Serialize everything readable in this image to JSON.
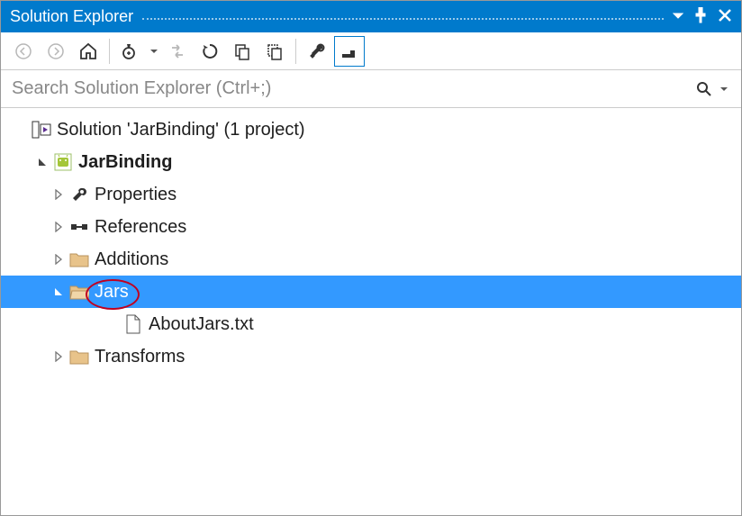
{
  "titlebar": {
    "title": "Solution Explorer"
  },
  "search": {
    "placeholder": "Search Solution Explorer (Ctrl+;)"
  },
  "tree": {
    "solution_label": "Solution 'JarBinding' (1 project)",
    "project_label": "JarBinding",
    "properties_label": "Properties",
    "references_label": "References",
    "additions_label": "Additions",
    "jars_label": "Jars",
    "aboutjars_label": "AboutJars.txt",
    "transforms_label": "Transforms"
  }
}
